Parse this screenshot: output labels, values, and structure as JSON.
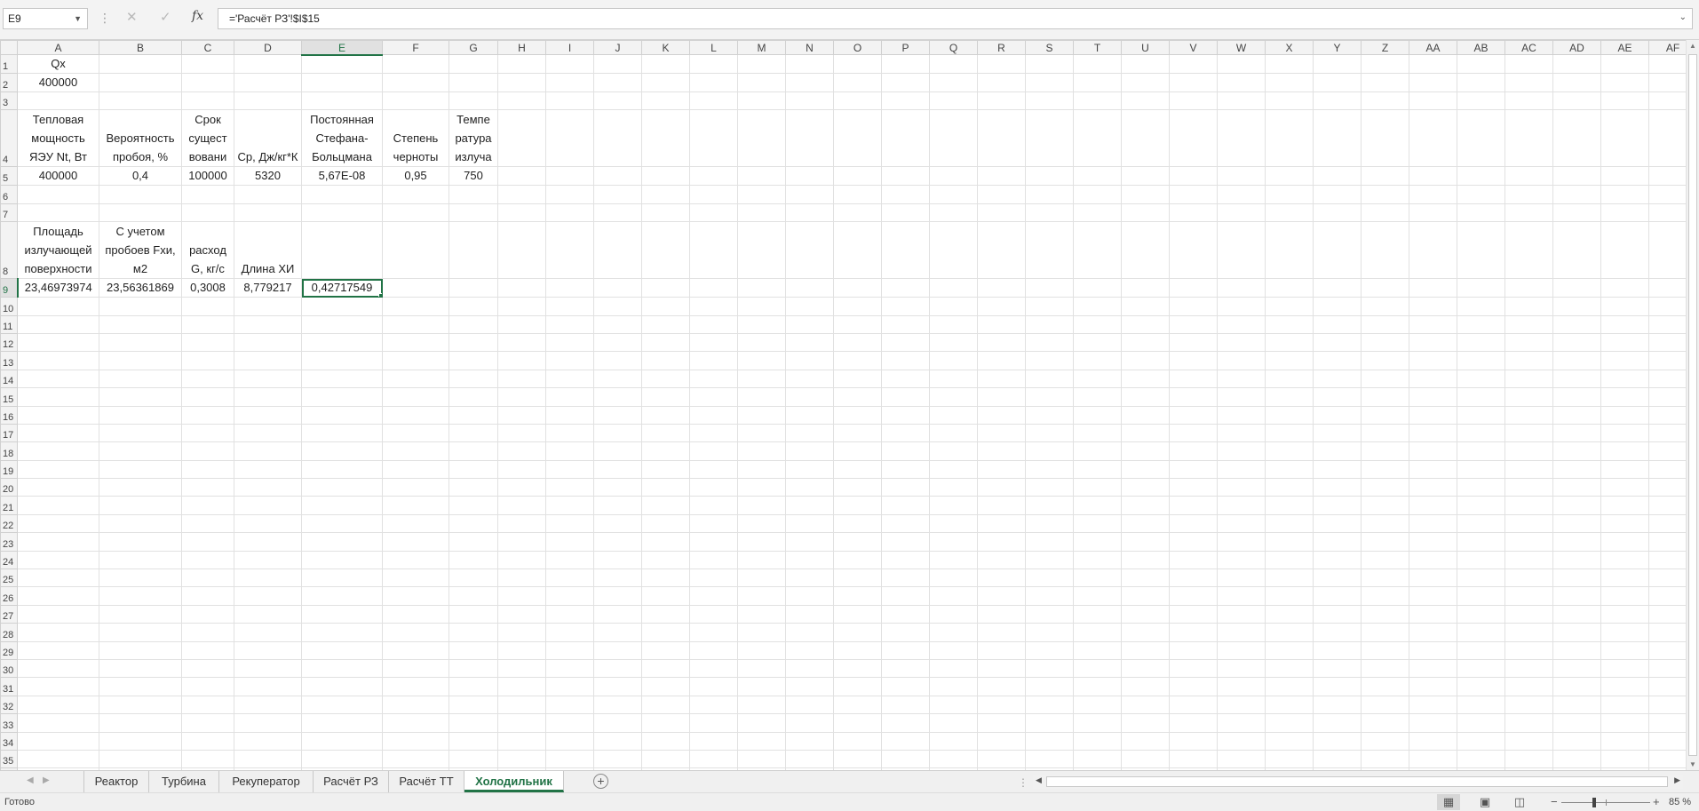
{
  "formula_bar": {
    "name_box": "E9",
    "cancel_icon": "✕",
    "enter_icon": "✓",
    "fx_label": "fx",
    "formula": "='Расчёт РЗ'!$I$15"
  },
  "grid": {
    "columns": [
      "A",
      "B",
      "C",
      "D",
      "E",
      "F",
      "G",
      "H",
      "I",
      "J",
      "K",
      "L",
      "M",
      "N",
      "O",
      "P",
      "Q",
      "R",
      "S",
      "T",
      "U",
      "V",
      "W",
      "X",
      "Y",
      "Z",
      "AA",
      "AB",
      "AC",
      "AD",
      "AE",
      "AF"
    ],
    "selected_column": "E",
    "selected_row": 9,
    "row_count": 39,
    "cells": {
      "A1": "Qx",
      "A2": "400000",
      "A4": "Тепловая мощность ЯЭУ Nt, Вт",
      "B4": "Вероятность пробоя, %",
      "C4": "Срок сущест вовани",
      "D4": "Ср, Дж/кг*К",
      "E4": "Постоянная Стефана-Больцмана",
      "F4": "Степень черноты",
      "G4": "Темпе ратура излуча",
      "A5": "400000",
      "B5": "0,4",
      "C5": "100000",
      "D5": "5320",
      "E5": "5,67E-08",
      "F5": "0,95",
      "G5": "750",
      "A8": "Площадь излучающей поверхности",
      "B8": "С учетом пробоев Fхи, м2",
      "C8": "расход G, кг/с",
      "D8": "Длина ХИ",
      "A9": "23,46973974",
      "B9": "23,56361869",
      "C9": "0,3008",
      "D9": "8,779217",
      "E9": "0,42717549"
    }
  },
  "sheet_tabs": {
    "tabs": [
      "Реактор",
      "Турбина",
      "Рекуператор",
      "Расчёт РЗ",
      "Расчёт ТТ",
      "Холодильник"
    ],
    "active": "Холодильник",
    "add_icon": "+"
  },
  "status_bar": {
    "status": "Готово",
    "zoom": "85 %",
    "zoom_minus": "−",
    "zoom_plus": "+"
  },
  "icons": {
    "name_box_dropdown": "chevron-down-icon",
    "view_normal": "grid-icon",
    "view_page_layout": "page-layout-icon",
    "view_page_break": "page-break-icon"
  },
  "colors": {
    "accent": "#217346",
    "header_bg": "#f3f3f3",
    "gridline": "#e1e1e1"
  }
}
